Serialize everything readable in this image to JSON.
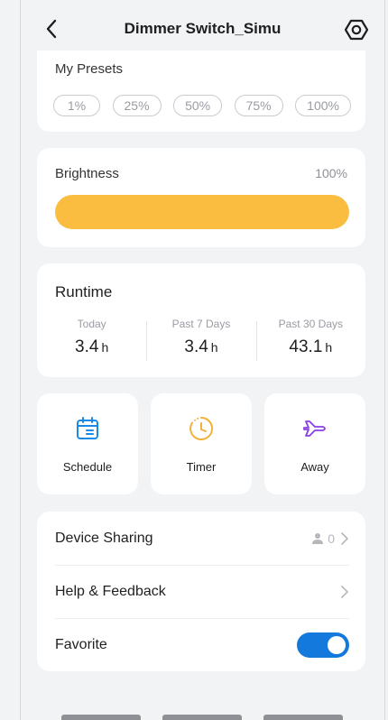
{
  "header": {
    "title": "Dimmer Switch_Simu"
  },
  "presets": {
    "label": "My Presets",
    "items": [
      "1%",
      "25%",
      "50%",
      "75%",
      "100%"
    ]
  },
  "brightness": {
    "label": "Brightness",
    "value_text": "100%",
    "level_percent": 100,
    "fill_color": "#fbbd3f"
  },
  "runtime": {
    "title": "Runtime",
    "columns": [
      {
        "label": "Today",
        "value": "3.4",
        "unit": "h"
      },
      {
        "label": "Past 7 Days",
        "value": "3.4",
        "unit": "h"
      },
      {
        "label": "Past 30 Days",
        "value": "43.1",
        "unit": "h"
      }
    ]
  },
  "tiles": [
    {
      "label": "Schedule",
      "icon": "calendar-icon",
      "color": "#1a8ae6"
    },
    {
      "label": "Timer",
      "icon": "clock-icon",
      "color": "#f2b13a"
    },
    {
      "label": "Away",
      "icon": "airplane-icon",
      "color": "#8c3fe0"
    }
  ],
  "list": {
    "sharing": {
      "label": "Device Sharing",
      "count": "0"
    },
    "help": {
      "label": "Help & Feedback"
    },
    "favorite": {
      "label": "Favorite",
      "enabled": true
    }
  },
  "colors": {
    "accent": "#1479dc",
    "background": "#f2f3f5"
  }
}
